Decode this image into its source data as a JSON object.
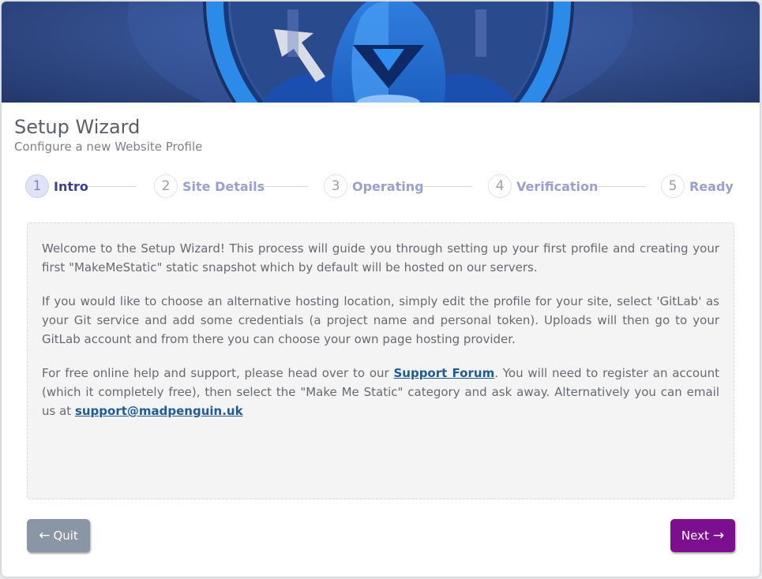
{
  "header": {
    "title": "Setup Wizard",
    "subtitle": "Configure a new Website Profile"
  },
  "steps": [
    {
      "number": "1",
      "label": "Intro",
      "active": true
    },
    {
      "number": "2",
      "label": "Site Details",
      "active": false
    },
    {
      "number": "3",
      "label": "Operating",
      "active": false
    },
    {
      "number": "4",
      "label": "Verification",
      "active": false
    },
    {
      "number": "5",
      "label": "Ready",
      "active": false
    }
  ],
  "intro": {
    "p1": "Welcome to the Setup Wizard! This process will guide you through setting up your first profile and creating your first \"MakeMeStatic\" static snapshot which by default will be hosted on our servers.",
    "p2": "If you would like to choose an alternative hosting location, simply edit the profile for your site, select 'GitLab' as your Git service and add some credentials (a project name and personal token). Uploads will then go to your GitLab account and from there you can choose your own page hosting provider.",
    "p3_before": "For free online help and support, please head over to our ",
    "p3_link": "Support Forum",
    "p3_middle": ". You will need to register an account (which it completely free), then select the \"Make Me Static\" category and ask away. Alternatively you can email us at ",
    "p3_email": "support@madpenguin.uk"
  },
  "buttons": {
    "quit_label": "Quit",
    "quit_icon": "arrow-left-icon",
    "next_label": "Next",
    "next_icon": "arrow-right-icon"
  },
  "colors": {
    "next_button": "#7c0f8f",
    "quit_button": "#8a95a5",
    "active_step": "#3b3f8f",
    "inactive_step": "#9a9fd0",
    "link": "#1f5b94"
  }
}
